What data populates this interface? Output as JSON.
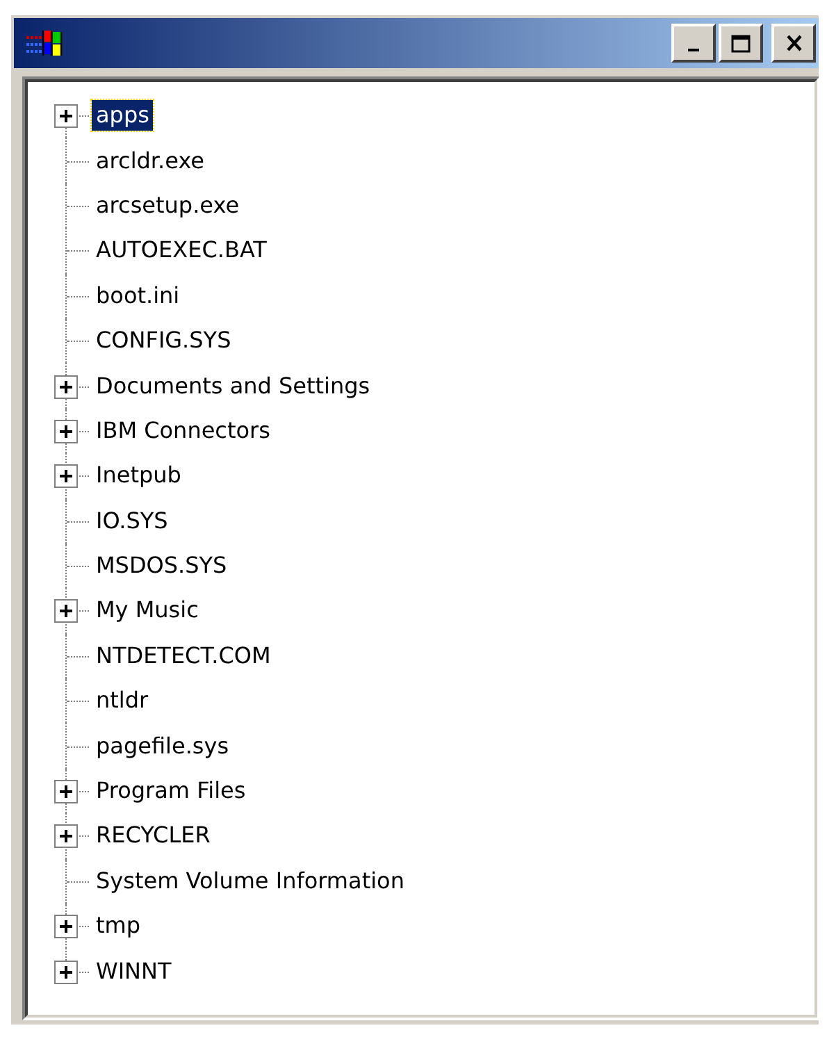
{
  "window": {
    "controls": [
      {
        "kind": "minimize"
      },
      {
        "kind": "maximize"
      },
      {
        "kind": "close"
      }
    ]
  },
  "tree": {
    "items": [
      {
        "label": "apps",
        "expandable": true,
        "selected": true
      },
      {
        "label": "arcldr.exe",
        "expandable": false,
        "selected": false
      },
      {
        "label": "arcsetup.exe",
        "expandable": false,
        "selected": false
      },
      {
        "label": "AUTOEXEC.BAT",
        "expandable": false,
        "selected": false
      },
      {
        "label": "boot.ini",
        "expandable": false,
        "selected": false
      },
      {
        "label": "CONFIG.SYS",
        "expandable": false,
        "selected": false
      },
      {
        "label": "Documents and Settings",
        "expandable": true,
        "selected": false
      },
      {
        "label": "IBM Connectors",
        "expandable": true,
        "selected": false
      },
      {
        "label": "Inetpub",
        "expandable": true,
        "selected": false
      },
      {
        "label": "IO.SYS",
        "expandable": false,
        "selected": false
      },
      {
        "label": "MSDOS.SYS",
        "expandable": false,
        "selected": false
      },
      {
        "label": "My Music",
        "expandable": true,
        "selected": false
      },
      {
        "label": "NTDETECT.COM",
        "expandable": false,
        "selected": false
      },
      {
        "label": "ntldr",
        "expandable": false,
        "selected": false
      },
      {
        "label": "pagefile.sys",
        "expandable": false,
        "selected": false
      },
      {
        "label": "Program Files",
        "expandable": true,
        "selected": false
      },
      {
        "label": "RECYCLER",
        "expandable": true,
        "selected": false
      },
      {
        "label": "System Volume Information",
        "expandable": false,
        "selected": false
      },
      {
        "label": "tmp",
        "expandable": true,
        "selected": false
      },
      {
        "label": "WINNT",
        "expandable": true,
        "selected": false
      }
    ]
  }
}
